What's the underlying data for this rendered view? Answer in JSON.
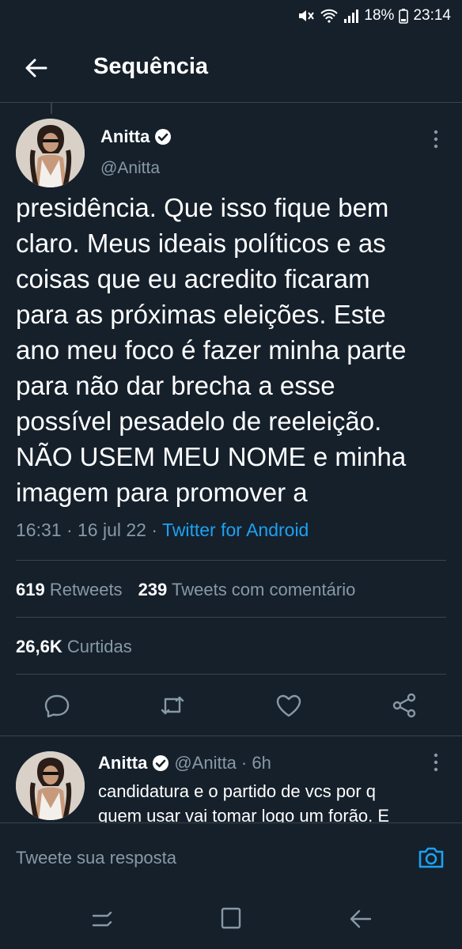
{
  "status_bar": {
    "battery": "18%",
    "time": "23:14"
  },
  "header": {
    "title": "Sequência"
  },
  "tweet": {
    "author_name": "Anitta",
    "author_handle": "@Anitta",
    "text": "presidência. Que isso fique bem\nclaro. Meus ideais políticos e as\ncoisas que eu acredito ficaram\npara as próximas eleições. Este\nano meu foco é fazer minha parte\npara não dar brecha a esse\npossível pesadelo de reeleição.\nNÃO USEM MEU NOME e minha\nimagem para promover a",
    "time": "16:31 · 16 jul 22 · ",
    "source": "Twitter for Android",
    "retweets_count": "619",
    "retweets_label": "Retweets",
    "quotes_count": "239",
    "quotes_label": "Tweets com comentário",
    "likes_count": "26,6K",
    "likes_label": "Curtidas"
  },
  "reply": {
    "author_name": "Anitta",
    "author_handle": "@Anitta",
    "age": "· 6h",
    "text": "candidatura e o partido de vcs por q\nquem usar vai tomar logo um forão. E"
  },
  "compose": {
    "placeholder": "Tweete sua resposta"
  },
  "colors": {
    "background": "#15202b",
    "accent": "#1da1f2",
    "secondary_text": "#8899a6",
    "divider": "#38444d"
  }
}
